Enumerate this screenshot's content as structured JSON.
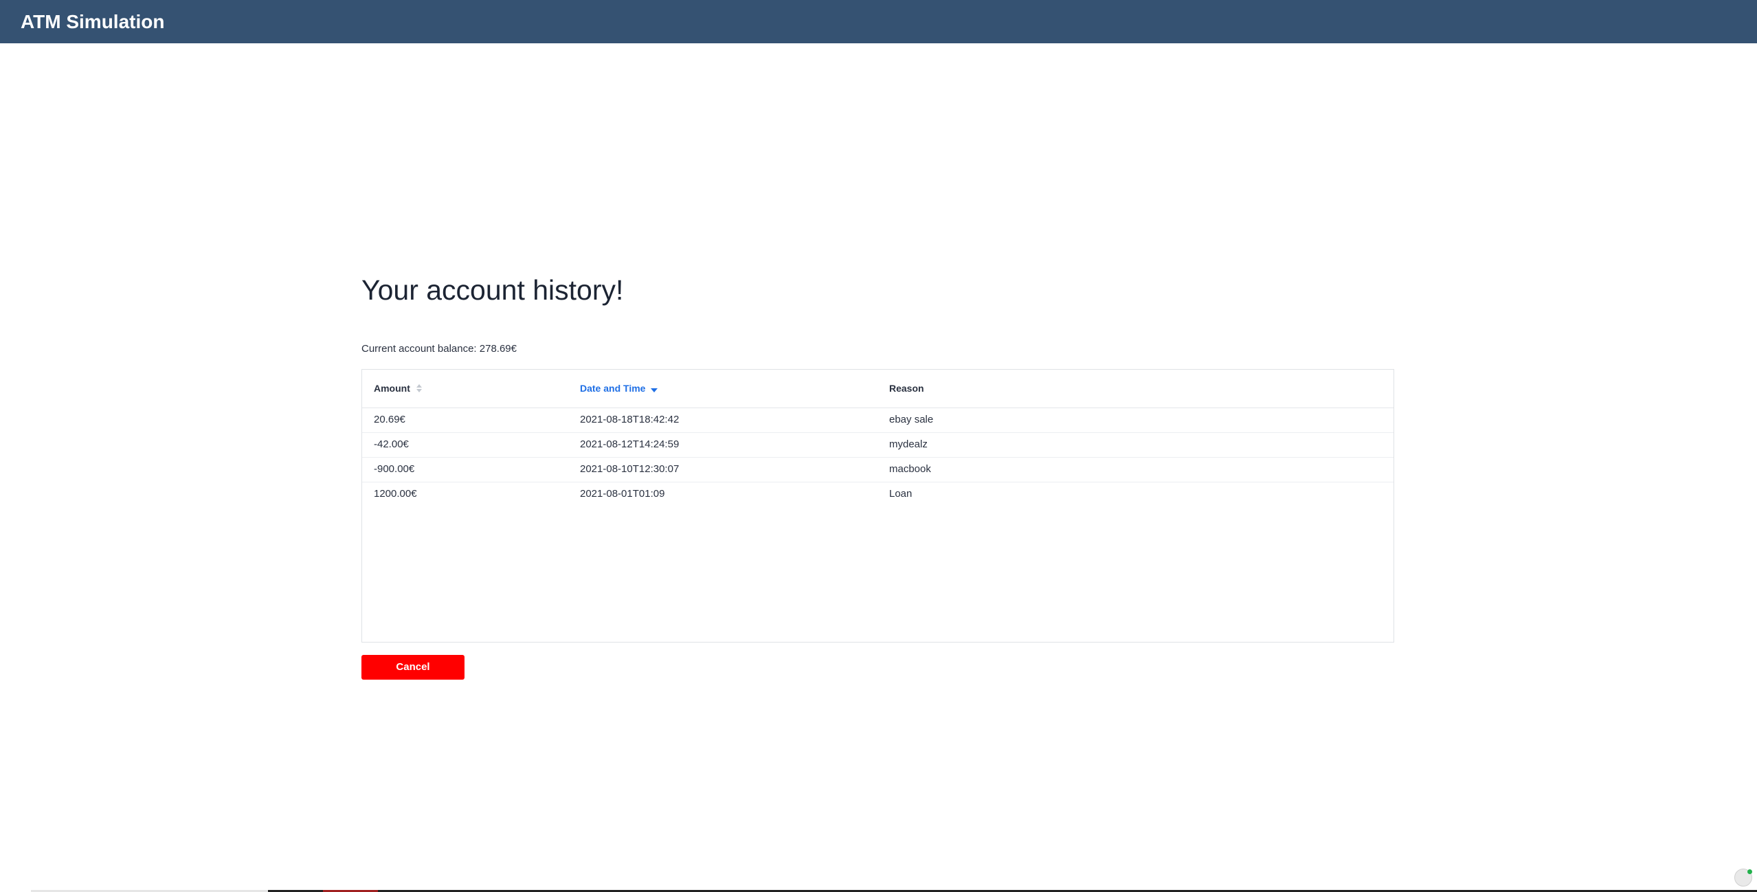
{
  "app": {
    "title": "ATM Simulation"
  },
  "page": {
    "heading": "Your account history!",
    "balance_text": "Current account balance: 278.69€"
  },
  "table": {
    "columns": {
      "amount": "Amount",
      "date": "Date and Time",
      "reason": "Reason"
    },
    "sort": {
      "column": "date",
      "direction": "descending"
    },
    "rows": [
      {
        "amount": "20.69€",
        "date": "2021-08-18T18:42:42",
        "reason": "ebay sale"
      },
      {
        "amount": "-42.00€",
        "date": "2021-08-12T14:24:59",
        "reason": "mydealz"
      },
      {
        "amount": "-900.00€",
        "date": "2021-08-10T12:30:07",
        "reason": "macbook"
      },
      {
        "amount": "1200.00€",
        "date": "2021-08-01T01:09",
        "reason": "Loan"
      }
    ]
  },
  "actions": {
    "cancel_label": "Cancel"
  },
  "colors": {
    "header_bg": "#355272",
    "accent": "#1f6fe5",
    "cancel_bg": "#ff0000"
  }
}
